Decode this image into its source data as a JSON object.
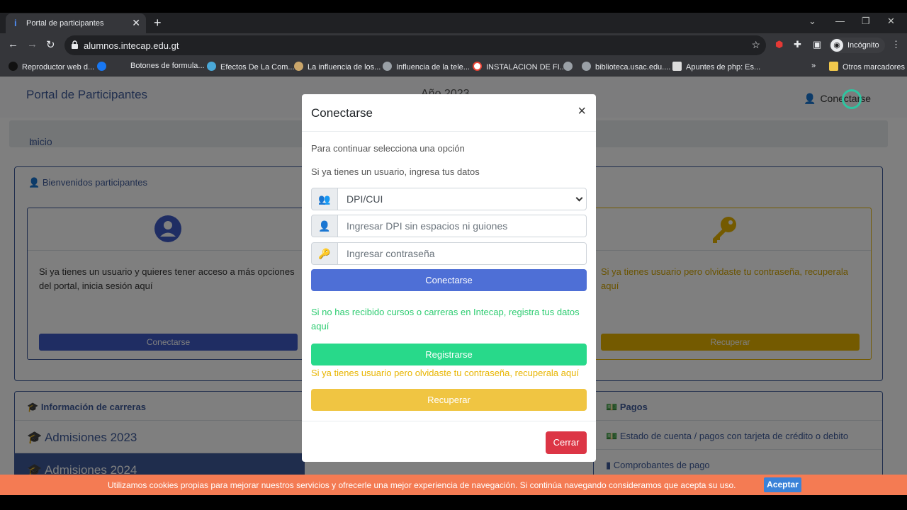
{
  "browser": {
    "tab_title": "Portal de participantes",
    "url": "alumnos.intecap.edu.gt",
    "profile_label": "Incógnito",
    "bookmarks": [
      "Reproductor web d...",
      "Botones de formula...",
      "Efectos De La Com...",
      "La influencia de los...",
      "Influencia de la tele...",
      "INSTALACION DE FI...",
      "biblioteca.usac.edu....",
      "Apuntes de php: Es..."
    ],
    "bookmarks_more": "»",
    "other_bookmarks": "Otros marcadores"
  },
  "page": {
    "brand": "Portal de Participantes",
    "year": "Año 2023",
    "login_link": "Conectarse",
    "breadcrumb": "Inicio",
    "welcome_title": "Bienvenidos participantes",
    "left_card_text": "Si ya tienes un usuario y quieres tener acceso a más opciones del portal, inicia sesión aquí",
    "left_card_button": "Conectarse",
    "right_card_text": "Si ya tienes usuario pero olvidaste tu contraseña, recuperala aquí",
    "right_card_button": "Recuperar",
    "careers_title": "Información de carreras",
    "careers": [
      "Admisiones 2023",
      "Admisiones 2024"
    ],
    "payments_title": "Pagos",
    "payments": [
      "Estado de cuenta / pagos con tarjeta de crédito o debito",
      "Comprobantes de pago"
    ]
  },
  "modal": {
    "title": "Conectarse",
    "close": "×",
    "intro": "Para continuar selecciona una opción",
    "subintro": "Si ya tienes un usuario, ingresa tus datos",
    "doc_type_selected": "DPI/CUI",
    "dpi_placeholder": "Ingresar DPI sin espacios ni guiones",
    "password_placeholder": "Ingresar contraseña",
    "connect_button": "Conectarse",
    "register_text": "Si no has recibido cursos o carreras en Intecap, registra tus datos aquí",
    "register_button": "Registrarse",
    "recover_text": "Si ya tienes usuario pero olvidaste tu contraseña, recuperala aquí",
    "recover_button": "Recuperar",
    "footer_close": "Cerrar"
  },
  "cookie": {
    "message": "Utilizamos cookies propias para mejorar nuestros servicios y ofrecerle una mejor experiencia de navegación. Si continúa navegando consideramos que acepta su uso.",
    "accept": "Aceptar"
  },
  "colors": {
    "primary": "#4e6fd6",
    "success": "#28d98a",
    "warning": "#f0c542",
    "danger": "#dc3545",
    "cookie_bar": "#f47b53"
  }
}
